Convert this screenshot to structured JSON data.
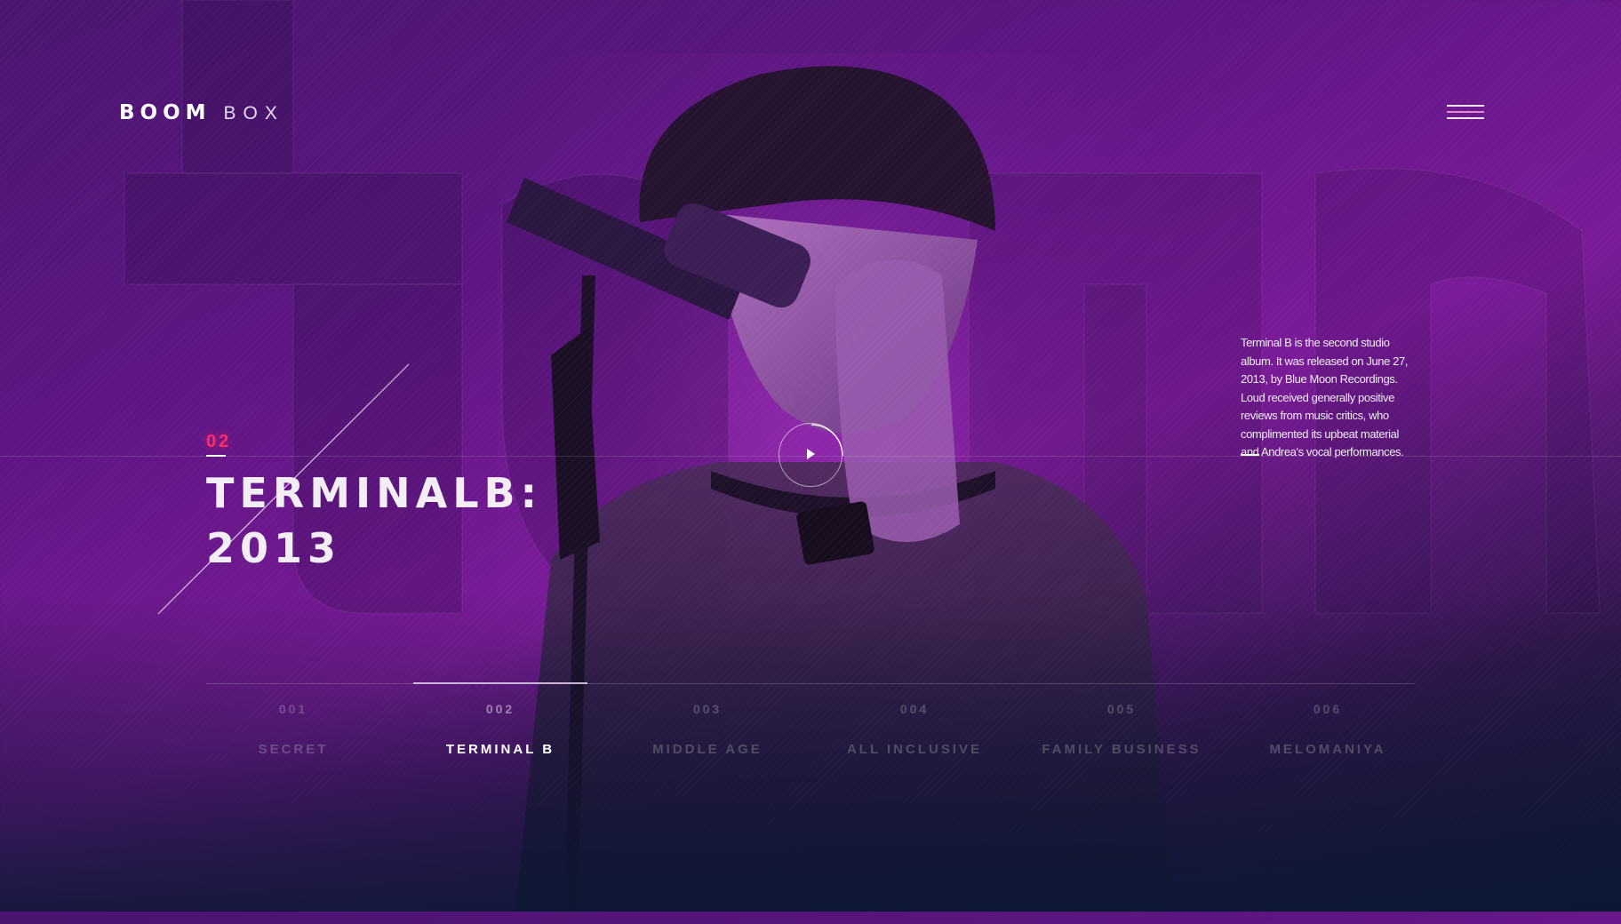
{
  "logo": {
    "boom": "BOOM",
    "box": "BOX"
  },
  "menu": {
    "icon": "hamburger-icon"
  },
  "hero": {
    "album_number": "02",
    "title_line1": "TERMINALB:",
    "title_line2": "2013",
    "bg_text": "LOUD"
  },
  "player": {
    "icon": "play-icon"
  },
  "description": {
    "text": "Terminal B is the second studio album. It was released on June 27, 2013, by Blue Moon Recordings. Loud received generally positive reviews from music critics, who complimented its upbeat material and Andrea's vocal performances."
  },
  "timeline": {
    "active_index": 1,
    "tracks": [
      {
        "num": "001",
        "name": "SECRET"
      },
      {
        "num": "002",
        "name": "TERMINAL B"
      },
      {
        "num": "003",
        "name": "MIDDLE AGE"
      },
      {
        "num": "004",
        "name": "ALL INCLUSIVE"
      },
      {
        "num": "005",
        "name": "FAMILY BUSINESS"
      },
      {
        "num": "006",
        "name": "MELOMANIYA"
      }
    ]
  },
  "colors": {
    "accent": "#ff2d6a",
    "bg_top": "#5d1582",
    "bg_bottom": "#0e1a36"
  }
}
